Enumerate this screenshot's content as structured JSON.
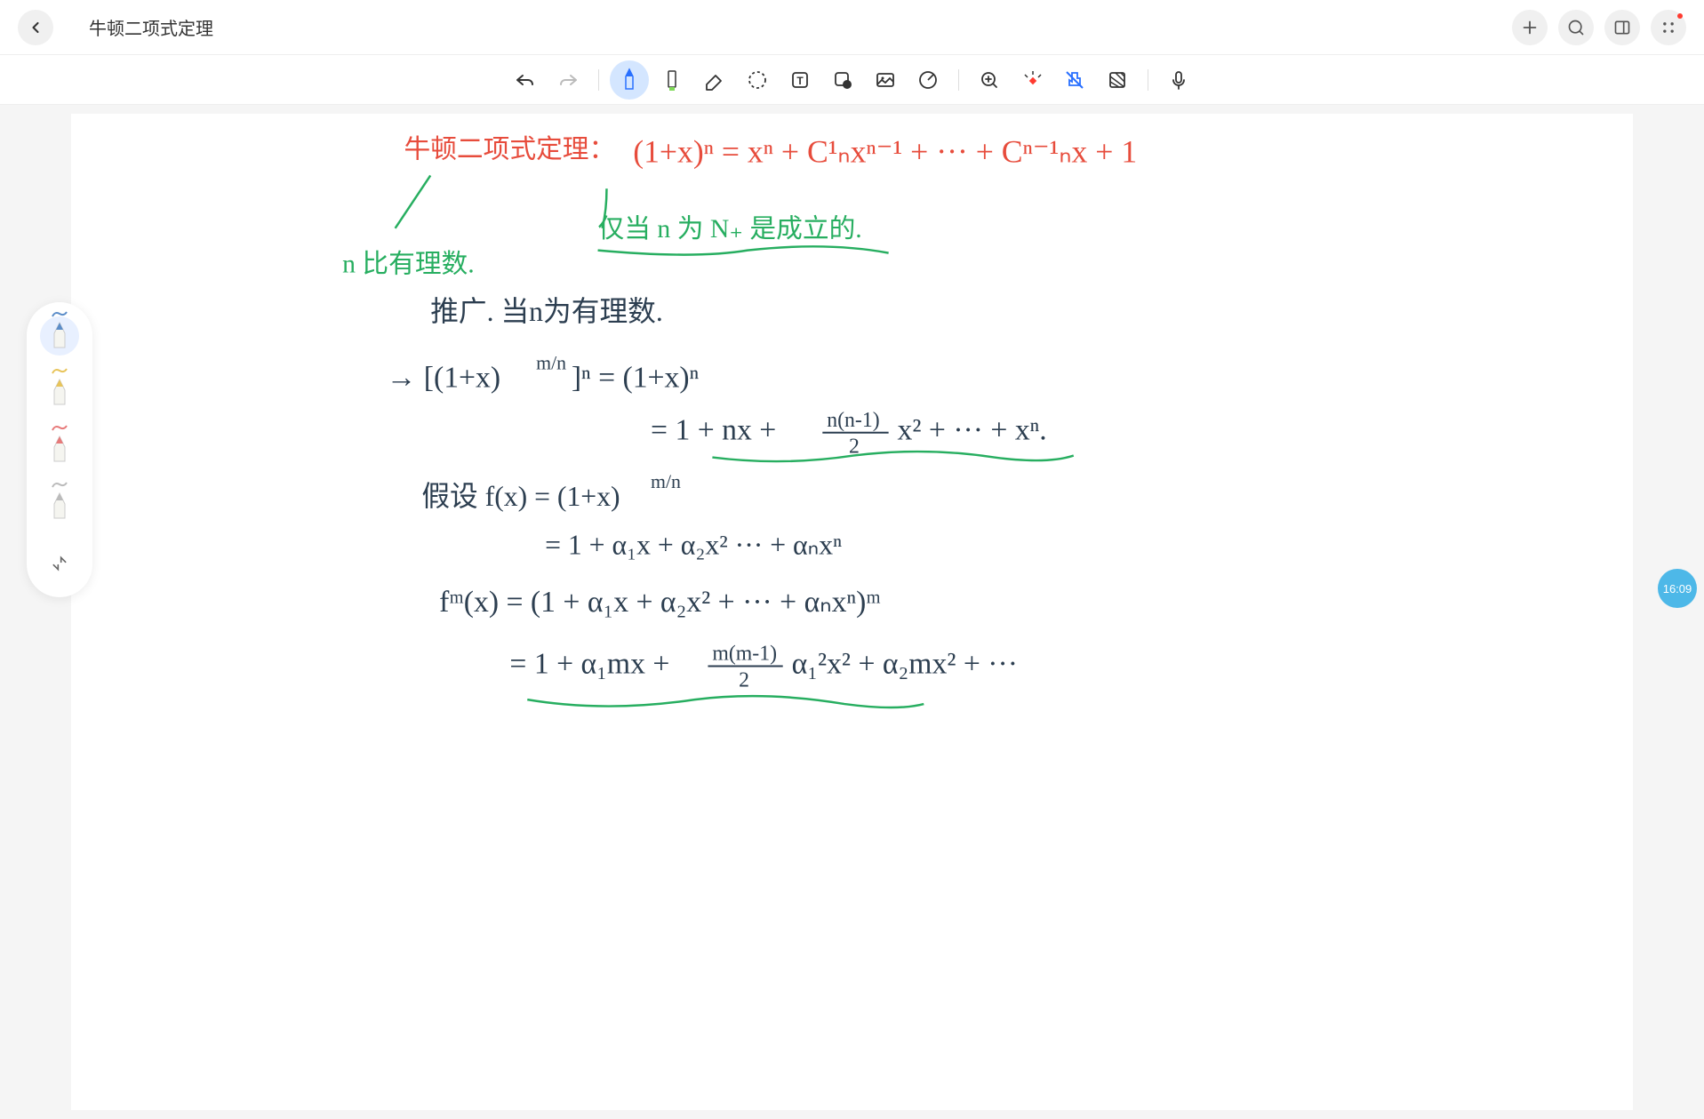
{
  "header": {
    "title": "牛顿二项式定理"
  },
  "toolbar": {
    "tools": [
      "undo",
      "redo",
      "pen",
      "highlighter",
      "eraser",
      "lasso",
      "text",
      "shape",
      "image",
      "sticker",
      "zoom",
      "laser",
      "touch-off",
      "pattern",
      "mic"
    ]
  },
  "time_badge": "16:09",
  "handwriting": {
    "line1_red": "牛顿二项式定理：",
    "line1_formula_red": "(1+x)ⁿ = xⁿ + C¹ₙxⁿ⁻¹ + ··· + Cⁿ⁻¹ₙx + 1",
    "line2_green_left": "n 比有理数.",
    "line2_green_right": "仅当 n 为 N₊ 是成立的.",
    "line3": "推广. 当n为有理数.",
    "line4": "→  [(1+x)^(m/n)]ⁿ  =  (1+x)ⁿ",
    "line5": "=  1 + nx + n(n-1)/2 x² + ··· + xⁿ.",
    "line6": "假设 f(x) = (1+x)^(m/n)",
    "line7": "=  1 + α₁x + α₂x² ··· + αₙxⁿ",
    "line8": "fᵐ(x)  =  (1 + α₁x + α₂x² + ··· + αₙxⁿ)ᵐ",
    "line9": "=  1 + α₁mx + m(m-1)/2 α₁²x² + α₂mx² + ···"
  },
  "colors": {
    "red": "#e74c3c",
    "green": "#27ae60",
    "dark": "#2c3e50",
    "accent_blue": "#4db8e8"
  }
}
